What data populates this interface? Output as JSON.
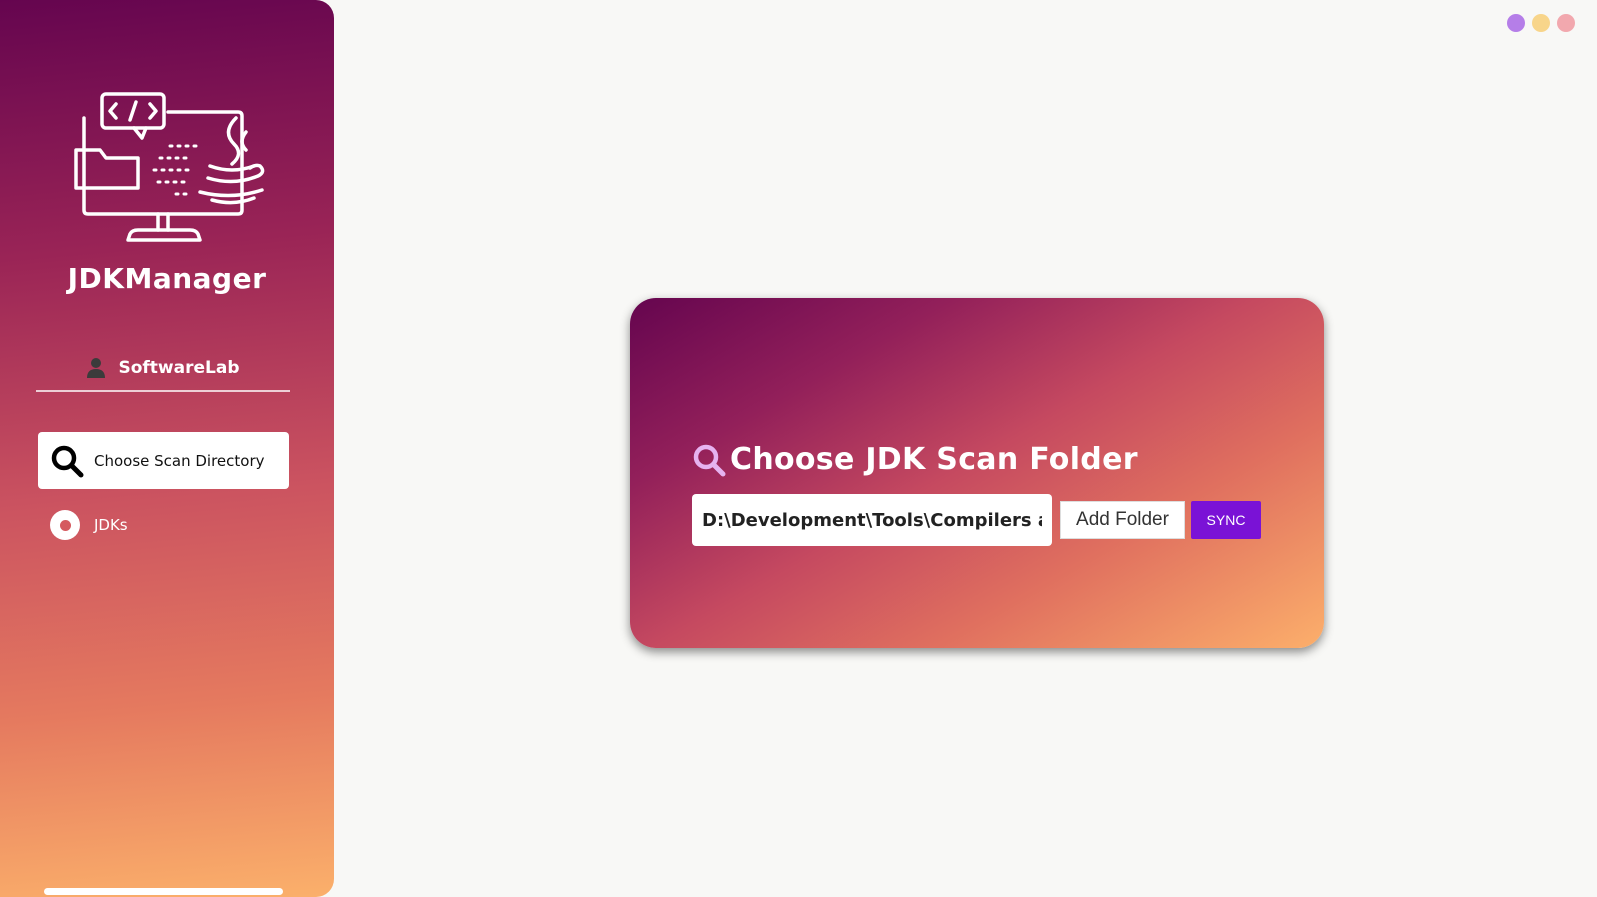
{
  "app": {
    "title": "JDKManager"
  },
  "sidebar": {
    "user_name": "SoftwareLab",
    "items": [
      {
        "label": "Choose Scan Directory",
        "icon": "search-icon",
        "active": true
      },
      {
        "label": "JDKs",
        "icon": "radio-icon",
        "active": false
      }
    ]
  },
  "window_controls": [
    {
      "name": "window-dot-purple",
      "color": "#b57ee8"
    },
    {
      "name": "window-dot-yellow",
      "color": "#f8d58a"
    },
    {
      "name": "window-dot-pink",
      "color": "#f2a8ae"
    }
  ],
  "main": {
    "card_title": "Choose JDK Scan Folder",
    "path_value": "D:\\Development\\Tools\\Compilers and SDKs\\Java",
    "add_folder_label": "Add Folder",
    "sync_label": "SYNC"
  },
  "colors": {
    "gradient_start": "#65054f",
    "gradient_end": "#fcaf6b",
    "sync_button": "#7a12d6",
    "background": "#f8f8f6"
  }
}
